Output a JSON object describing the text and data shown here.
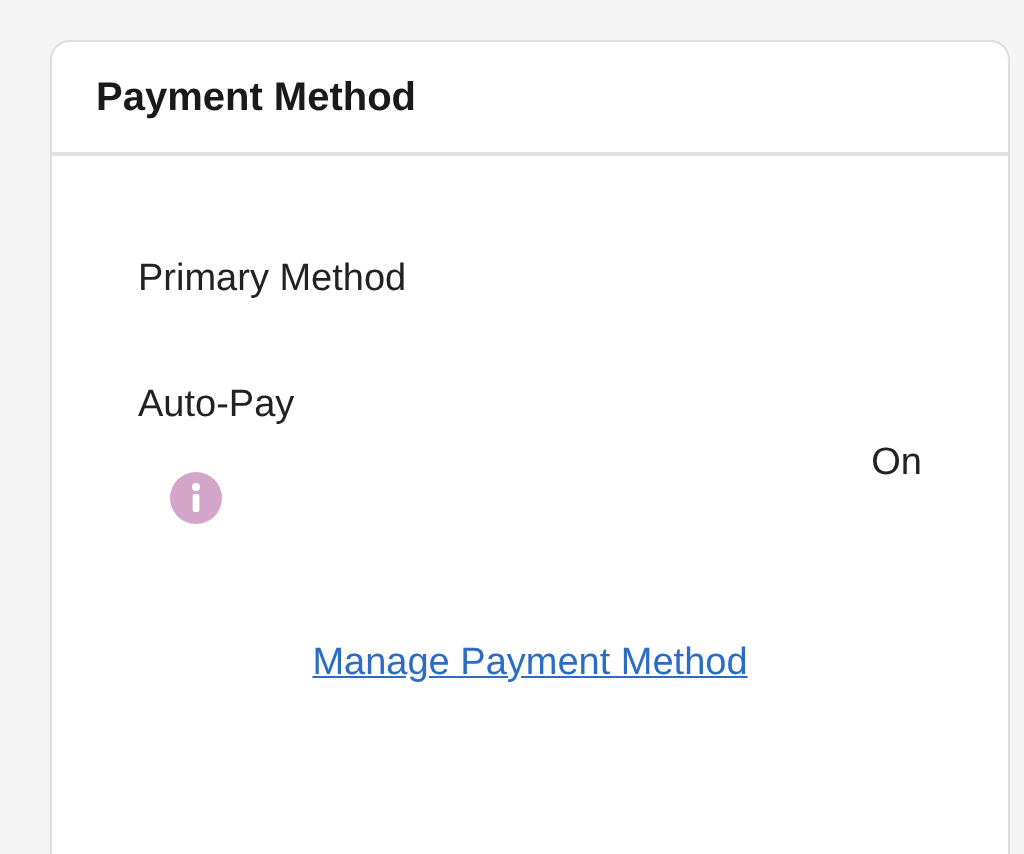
{
  "card": {
    "title": "Payment Method"
  },
  "rows": [
    {
      "kind": "plain",
      "label": "Primary Method"
    },
    {
      "kind": "info",
      "label": "Auto-Pay",
      "value": "On"
    }
  ],
  "link": "Manage Payment Method"
}
